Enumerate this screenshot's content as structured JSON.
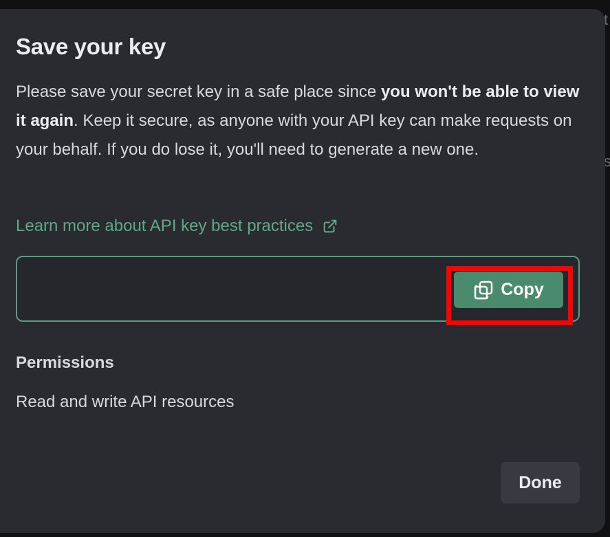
{
  "dialog": {
    "title": "Save your key",
    "description": {
      "part1": "Please save your secret key in a safe place since ",
      "bold": "you won't be able to view it again",
      "part2": ". Keep it secure, as anyone with your API key can make requests on your behalf. If you do lose it, you'll need to generate a new one."
    },
    "learn_more_link": "Learn more about API key best practices",
    "key_field": {
      "value": "",
      "copy_label": "Copy"
    },
    "permissions": {
      "label": "Permissions",
      "value": "Read and write API resources"
    },
    "done_label": "Done"
  },
  "background": {
    "char_top": "t",
    "char_mid": "s"
  },
  "icons": {
    "external_link": "external-link-icon",
    "copy": "copy-icon"
  },
  "colors": {
    "accent": "#5ea886",
    "copy_button": "#4a8a6d",
    "modal_bg": "#2a2b31",
    "highlight": "#ff0000"
  }
}
